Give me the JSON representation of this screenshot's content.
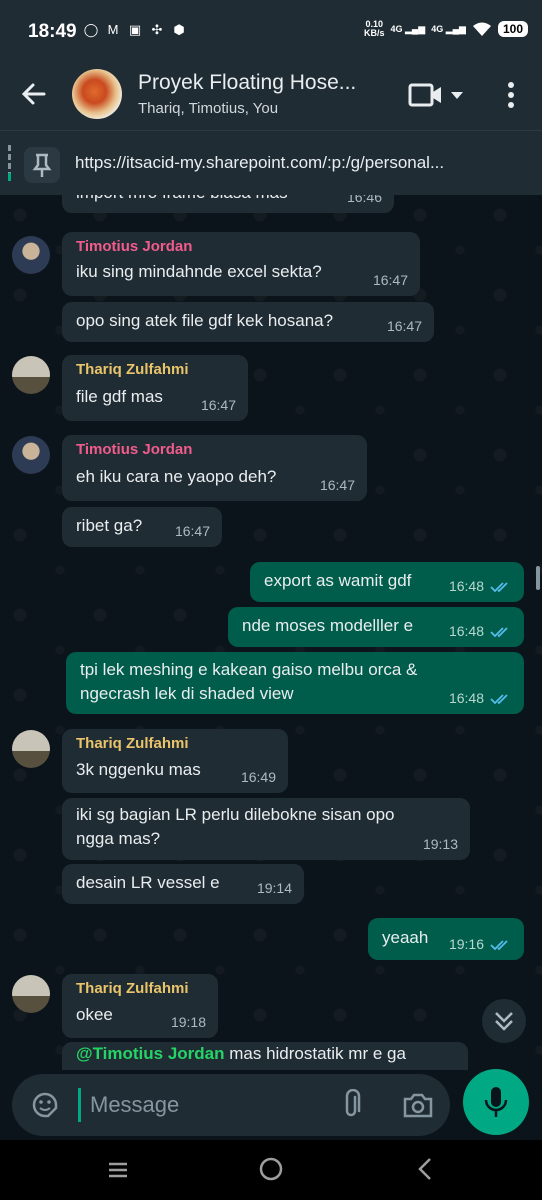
{
  "status": {
    "time": "18:49",
    "netspeed_value": "0.10",
    "netspeed_unit": "KB/s",
    "sim1": "4G",
    "sim2": "4G",
    "battery": "100"
  },
  "header": {
    "title": "Proyek Floating Hose...",
    "subtitle": "Thariq, Timotius, You"
  },
  "pinned": {
    "text": "https://itsacid-my.sharepoint.com/:p:/g/personal..."
  },
  "messages": [
    {
      "text": "import mro frame biasa mas",
      "time": "16:46"
    },
    {
      "sender": "Timotius Jordan",
      "text": "iku sing mindahnde excel sekta?",
      "time": "16:47"
    },
    {
      "text": "opo sing atek file gdf kek hosana?",
      "time": "16:47"
    },
    {
      "sender": "Thariq Zulfahmi",
      "text": "file gdf mas",
      "time": "16:47"
    },
    {
      "sender": "Timotius Jordan",
      "text": "eh iku cara ne yaopo deh?",
      "time": "16:47"
    },
    {
      "text": "ribet ga?",
      "time": "16:47"
    },
    {
      "text": "export as wamit gdf",
      "time": "16:48"
    },
    {
      "text": "nde moses modelller e",
      "time": "16:48"
    },
    {
      "text_line1": "tpi lek meshing e kakean gaiso melbu orca &",
      "text_line2": "ngecrash lek di shaded view",
      "time": "16:48"
    },
    {
      "sender": "Thariq Zulfahmi",
      "text": "3k nggenku mas",
      "time": "16:49"
    },
    {
      "text_line1": "iki sg bagian LR perlu dilebokne sisan opo",
      "text_line2": "ngga mas?",
      "time": "19:13"
    },
    {
      "text": "desain LR vessel e",
      "time": "19:14"
    },
    {
      "text": "yeaah",
      "time": "19:16"
    },
    {
      "sender": "Thariq Zulfahmi",
      "text": "okee",
      "time": "19:18"
    },
    {
      "mention": "@Timotius Jordan",
      "text": " mas hidrostatik mr e ga"
    }
  ],
  "input": {
    "placeholder": "Message"
  },
  "colors": {
    "accent": "#00a884",
    "outgoing": "#005c4b",
    "incoming": "#202c33",
    "tick": "#53bdeb"
  }
}
